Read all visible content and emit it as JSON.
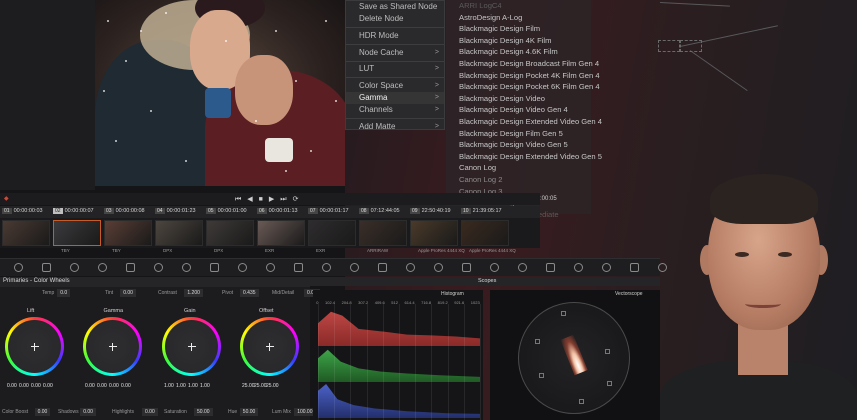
{
  "context_menu": {
    "items": [
      {
        "label": "Save as Shared Node",
        "submenu": false
      },
      {
        "label": "Delete Node",
        "submenu": false
      },
      {
        "sep": true
      },
      {
        "label": "HDR Mode",
        "submenu": false
      },
      {
        "sep": true
      },
      {
        "label": "Node Cache",
        "submenu": true
      },
      {
        "sep": true
      },
      {
        "label": "LUT",
        "submenu": true
      },
      {
        "sep": true
      },
      {
        "label": "Color Space",
        "submenu": true
      },
      {
        "label": "Gamma",
        "submenu": true,
        "highlighted": true
      },
      {
        "label": "Channels",
        "submenu": true
      },
      {
        "sep": true
      },
      {
        "label": "Add Matte",
        "submenu": true
      }
    ],
    "arrow_glyph": ">"
  },
  "gamma_submenu": {
    "items": [
      {
        "label": "ARRI LogC4",
        "style": "faint"
      },
      {
        "label": "AstroDesign A-Log"
      },
      {
        "label": "Blackmagic Design Film"
      },
      {
        "label": "Blackmagic Design 4K Film"
      },
      {
        "label": "Blackmagic Design 4.6K Film"
      },
      {
        "label": "Blackmagic Design Broadcast Film Gen 4"
      },
      {
        "label": "Blackmagic Design Pocket 4K Film Gen 4"
      },
      {
        "label": "Blackmagic Design Pocket 6K Film Gen 4"
      },
      {
        "label": "Blackmagic Design Video"
      },
      {
        "label": "Blackmagic Design Video Gen 4"
      },
      {
        "label": "Blackmagic Design Extended Video Gen 4"
      },
      {
        "label": "Blackmagic Design Film Gen 5"
      },
      {
        "label": "Blackmagic Design Video Gen 5"
      },
      {
        "label": "Blackmagic Design Extended Video Gen 5"
      },
      {
        "label": "Canon Log"
      },
      {
        "label": "Canon Log 2",
        "style": "dim"
      },
      {
        "label": "Canon Log 3",
        "style": "dim"
      },
      {
        "label": "Cineon Film Log",
        "style": "dim"
      },
      {
        "label": "Cineon Film Log Intermediate",
        "style": "faint"
      }
    ]
  },
  "transport": {
    "time_label": "01:00:00:05"
  },
  "timeline": {
    "clips": [
      {
        "num": "01",
        "tc": "00:00:00:03",
        "track": "V1",
        "label": "",
        "color": "#4a3a33"
      },
      {
        "num": "02",
        "tc": "00:00:00:07",
        "track": "V1",
        "label": "TBY",
        "color": "#3b3a3d"
      },
      {
        "num": "03",
        "tc": "00:00:00:08",
        "track": "V1",
        "label": "TBY",
        "color": "#5a3e35"
      },
      {
        "num": "04",
        "tc": "00:00:01:23",
        "track": "V1",
        "label": "DPX",
        "color": "#4d463f"
      },
      {
        "num": "05",
        "tc": "00:00:01:00",
        "track": "V1",
        "label": "DPX",
        "color": "#3e3a38"
      },
      {
        "num": "06",
        "tc": "00:00:01:13",
        "track": "V1",
        "label": "EXR",
        "color": "#6a5a55"
      },
      {
        "num": "07",
        "tc": "00:00:01:17",
        "track": "V1",
        "label": "EXR",
        "color": "#2e2c2e"
      },
      {
        "num": "08",
        "tc": "07:12:44:05",
        "track": "V1",
        "label": "ARRIRAW",
        "color": "#3a2e28"
      },
      {
        "num": "09",
        "tc": "22:50:40:19",
        "track": "V1",
        "label": "Apple ProRes 4444 XQ",
        "color": "#4a3a2a"
      },
      {
        "num": "10",
        "tc": "21:39:05:17",
        "track": "V1",
        "label": "Apple ProRes 4444 XQ",
        "color": "#3a2a1f"
      }
    ],
    "selected": 1
  },
  "color_wheels": {
    "title": "Primaries - Color Wheels",
    "params": [
      {
        "label": "Temp",
        "value": "0.0"
      },
      {
        "label": "Tint",
        "value": "0.00"
      },
      {
        "label": "Contrast",
        "value": "1.200"
      },
      {
        "label": "Pivot",
        "value": "0.435"
      },
      {
        "label": "Mid/Detail",
        "value": "0.00"
      }
    ],
    "wheels": [
      {
        "name": "Lift",
        "values": [
          "0.00",
          "0.00",
          "0.00",
          "0.00"
        ]
      },
      {
        "name": "Gamma",
        "values": [
          "0.00",
          "0.00",
          "0.00",
          "0.00"
        ]
      },
      {
        "name": "Gain",
        "values": [
          "1.00",
          "1.00",
          "1.00",
          "1.00"
        ]
      },
      {
        "name": "Offset",
        "values": [
          "25.00",
          "25.00",
          "25.00"
        ]
      }
    ],
    "channel_labels": [
      "Y",
      "R",
      "G",
      "B"
    ],
    "bottom": [
      {
        "label": "Color Boost",
        "value": "0.00"
      },
      {
        "label": "Shadows",
        "value": "0.00"
      },
      {
        "label": "Highlights",
        "value": "0.00"
      },
      {
        "label": "Saturation",
        "value": "50.00"
      },
      {
        "label": "Hue",
        "value": "50.00"
      },
      {
        "label": "Lum Mix",
        "value": "100.00"
      }
    ]
  },
  "scopes": {
    "title": "Scopes",
    "histogram_title": "Histogram",
    "histogram_scale": [
      "0",
      "102.4",
      "204.8",
      "307.2",
      "409.6",
      "512",
      "614.4",
      "716.8",
      "819.2",
      "921.6",
      "1023"
    ],
    "vectorscope_title": "Vectorscope"
  }
}
